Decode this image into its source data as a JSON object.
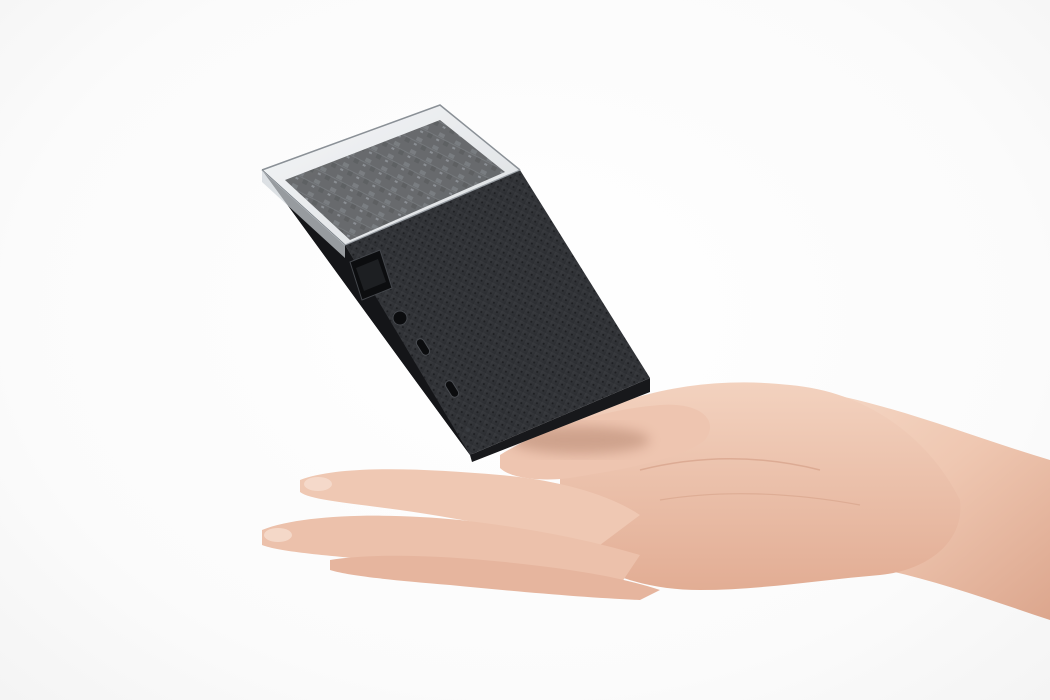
{
  "image": {
    "subject": "floating-mini-pc",
    "colors": {
      "background": "#ffffff",
      "device_body": "#2b2d31",
      "device_top_mesh": "#35373b",
      "transparent_cap": "#dfe3e7",
      "circuit_board": "#1c1f22",
      "skin": "#efc9b4",
      "skin_shadow": "#d9a58c"
    },
    "device": {
      "ports": [
        "ethernet-port",
        "audio-jack",
        "usb-c-port",
        "usb-c-port"
      ]
    }
  }
}
